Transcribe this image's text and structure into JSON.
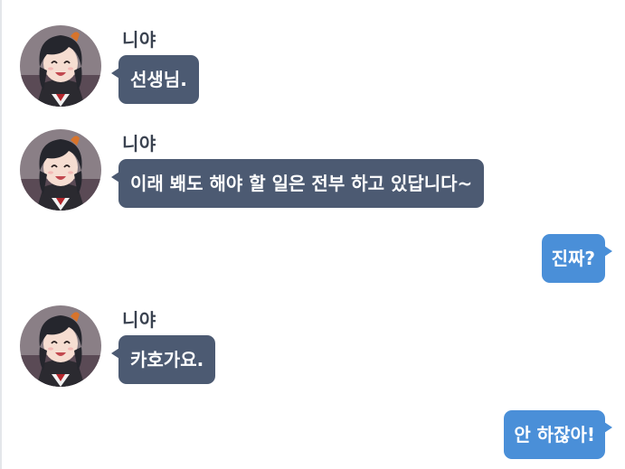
{
  "thread": {
    "messages": [
      {
        "direction": "incoming",
        "sender": "니야",
        "text": "선생님."
      },
      {
        "direction": "incoming",
        "sender": "니야",
        "text": "이래 봬도 해야 할 일은 전부 하고 있답니다~"
      },
      {
        "direction": "outgoing",
        "text": "진짜?"
      },
      {
        "direction": "incoming",
        "sender": "니야",
        "text": "카호가요."
      },
      {
        "direction": "outgoing",
        "text": "안 하잖아!"
      }
    ]
  },
  "avatar": {
    "icon": "character-portrait-icon",
    "bg_color": "#8a7f86",
    "hair_color": "#25262d",
    "skin_color": "#f6ddd1",
    "accent_color": "#d8742b"
  },
  "colors": {
    "incoming_bubble": "#4c5a72",
    "outgoing_bubble": "#4a8fd8",
    "sender_name": "#3a4250"
  }
}
